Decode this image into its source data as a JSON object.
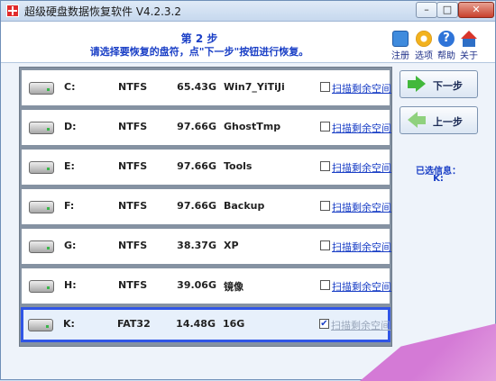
{
  "window": {
    "title": "超级硬盘数据恢复软件 V4.2.3.2",
    "controls": {
      "minimize": "–",
      "maximize": "□",
      "close": "✕"
    }
  },
  "header": {
    "step_title": "第 2 步",
    "step_instruction": "请选择要恢复的盘符，点\"下一步\"按钮进行恢复。"
  },
  "toolbar": {
    "register": {
      "label": "注册",
      "icon": "register-icon"
    },
    "options": {
      "label": "选项",
      "icon": "gear-icon"
    },
    "help": {
      "label": "帮助",
      "icon": "help-icon"
    },
    "about": {
      "label": "关于",
      "icon": "house-icon"
    }
  },
  "disks": [
    {
      "letter": "C:",
      "fs": "NTFS",
      "size": "65.43G",
      "label": "Win7_YiTiJi",
      "scan": "扫描剩余空间",
      "checked": false,
      "selected": false
    },
    {
      "letter": "D:",
      "fs": "NTFS",
      "size": "97.66G",
      "label": "GhostTmp",
      "scan": "扫描剩余空间",
      "checked": false,
      "selected": false
    },
    {
      "letter": "E:",
      "fs": "NTFS",
      "size": "97.66G",
      "label": "Tools",
      "scan": "扫描剩余空间",
      "checked": false,
      "selected": false
    },
    {
      "letter": "F:",
      "fs": "NTFS",
      "size": "97.66G",
      "label": "Backup",
      "scan": "扫描剩余空间",
      "checked": false,
      "selected": false
    },
    {
      "letter": "G:",
      "fs": "NTFS",
      "size": "38.37G",
      "label": "XP",
      "scan": "扫描剩余空间",
      "checked": false,
      "selected": false
    },
    {
      "letter": "H:",
      "fs": "NTFS",
      "size": "39.06G",
      "label": "镜像",
      "scan": "扫描剩余空间",
      "checked": false,
      "selected": false
    },
    {
      "letter": "K:",
      "fs": "FAT32",
      "size": "14.48G",
      "label": "16G",
      "scan": "扫描剩余空间",
      "checked": true,
      "selected": true
    }
  ],
  "nav": {
    "next_label": "下一步",
    "prev_label": "上一步"
  },
  "selection_info": {
    "title": "已选信息：",
    "value": "K:"
  },
  "colors": {
    "accent": "#1a3fc6",
    "selected_border": "#2f55e6",
    "list_bg": "#8592a2"
  }
}
